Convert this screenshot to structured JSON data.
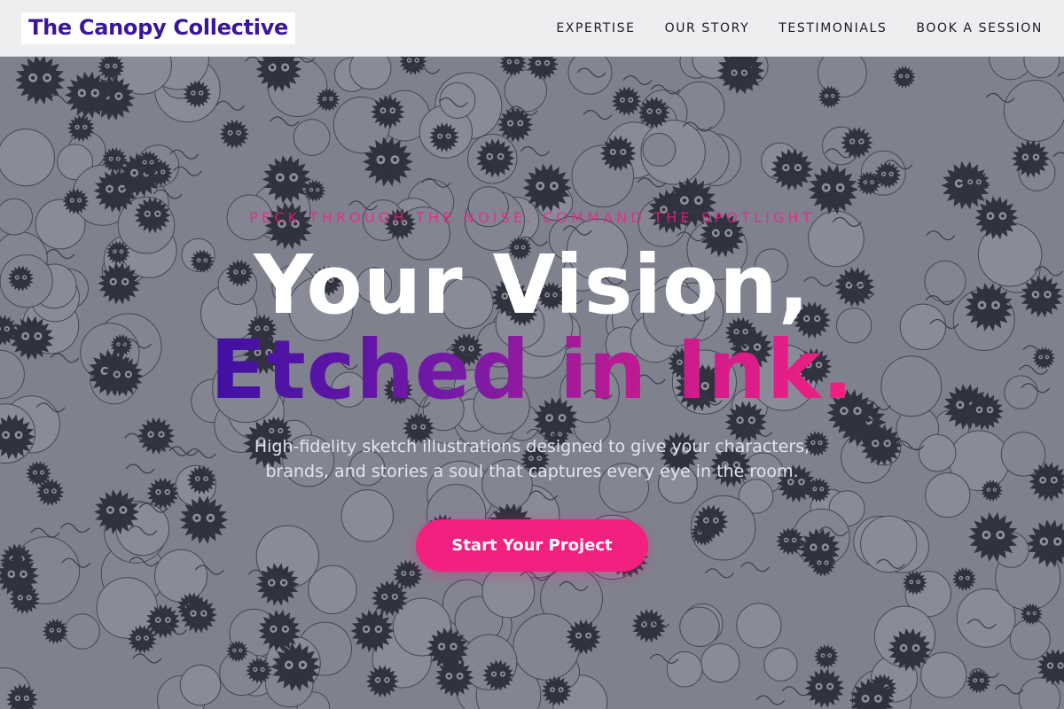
{
  "brand": {
    "name": "The Canopy Collective"
  },
  "nav": {
    "items": [
      {
        "label": "EXPERTISE"
      },
      {
        "label": "OUR STORY"
      },
      {
        "label": "TESTIMONIALS"
      },
      {
        "label": "BOOK A SESSION"
      }
    ]
  },
  "hero": {
    "tagline": "PECK THROUGH THE NOISE. COMMAND THE SPOTLIGHT",
    "headline_line1": "Your Vision,",
    "headline_line2": "Etched in Ink.",
    "subtitle_line1": "High-fidelity sketch illustrations designed to give your characters,",
    "subtitle_line2": "brands, and stories a soul that captures every eye in the room.",
    "cta_label": "Start Your Project",
    "background": "ink doodle collage"
  },
  "colors": {
    "brand_purple": "#3b1699",
    "accent_pink": "#f2207e",
    "gradient_start": "#3f10a3",
    "gradient_end": "#f3207e",
    "navbar_bg": "#eeeef1"
  }
}
